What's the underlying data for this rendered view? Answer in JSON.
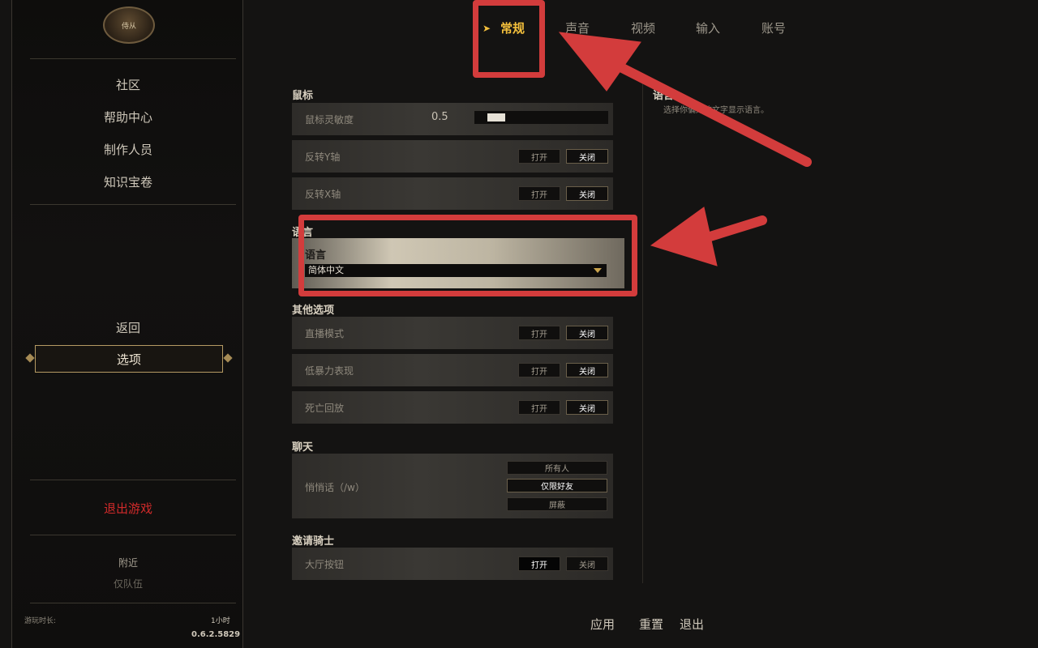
{
  "sidebar": {
    "crest_text": "侍从",
    "links_top": [
      "社区",
      "帮助中心",
      "制作人员",
      "知识宝卷"
    ],
    "back": "返回",
    "options": "选项",
    "quit": "退出游戏",
    "nearby": "附近",
    "party_only": "仅队伍",
    "playtime_label": "游玩时长:",
    "playtime_value": "1小时",
    "version": "0.6.2.5829"
  },
  "tabs": [
    "常规",
    "声音",
    "视频",
    "输入",
    "账号"
  ],
  "active_tab": "常规",
  "sections": {
    "mouse": {
      "title": "鼠标",
      "sensitivity_label": "鼠标灵敏度",
      "sensitivity_value": "0.5",
      "sensitivity_fraction": 0.15,
      "invert_y": "反转Y轴",
      "invert_x": "反转X轴"
    },
    "language": {
      "title": "语言",
      "label": "语言",
      "selected": "简体中文"
    },
    "other": {
      "title": "其他选项",
      "streamer_mode": "直播模式",
      "low_violence": "低暴力表现",
      "death_replay": "死亡回放"
    },
    "chat": {
      "title": "聊天",
      "whisper_label": "悄悄话（/w）",
      "options": [
        "所有人",
        "仅限好友",
        "屏蔽"
      ],
      "selected": "仅限好友"
    },
    "invite": {
      "title": "邀请骑士",
      "lobby_button": "大厅按钮"
    }
  },
  "toggle": {
    "on": "打开",
    "off": "关闭"
  },
  "info": {
    "title": "语言",
    "desc": "选择你偏好的文字显示语言。"
  },
  "footer": {
    "apply": "应用",
    "reset": "重置",
    "exit": "退出"
  },
  "annotation_color": "#d33c3c"
}
